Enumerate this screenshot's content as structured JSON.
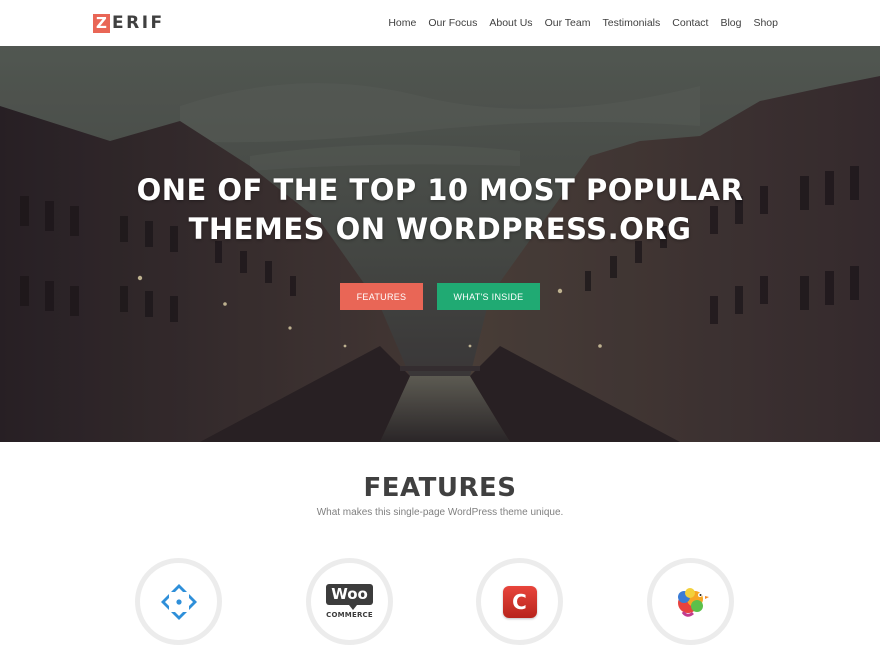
{
  "header": {
    "logo_mark": "Z",
    "logo_text": "ERIF",
    "nav": [
      "Home",
      "Our Focus",
      "About Us",
      "Our Team",
      "Testimonials",
      "Contact",
      "Blog",
      "Shop"
    ]
  },
  "hero": {
    "title_line1": "ONE OF THE TOP 10 MOST POPULAR",
    "title_line2": "THEMES ON WORDPRESS.ORG",
    "button_features": "FEATURES",
    "button_inside": "WHAT'S INSIDE"
  },
  "features": {
    "title": "FEATURES",
    "subtitle": "What makes this single-page WordPress theme unique.",
    "items": [
      {
        "icon": "move-arrows-icon"
      },
      {
        "icon": "woocommerce-logo",
        "logo_text_top": "Woo",
        "logo_text_bottom": "COMMERCE"
      },
      {
        "icon": "c-logo-icon",
        "logo_letter": "C"
      },
      {
        "icon": "colorful-bird-icon"
      }
    ]
  },
  "colors": {
    "accent_red": "#e96656",
    "accent_green": "#20aa73",
    "text_dark": "#404040",
    "text_muted": "#808080",
    "circle_border": "#ececec",
    "icon_blue": "#2e8fd9"
  }
}
